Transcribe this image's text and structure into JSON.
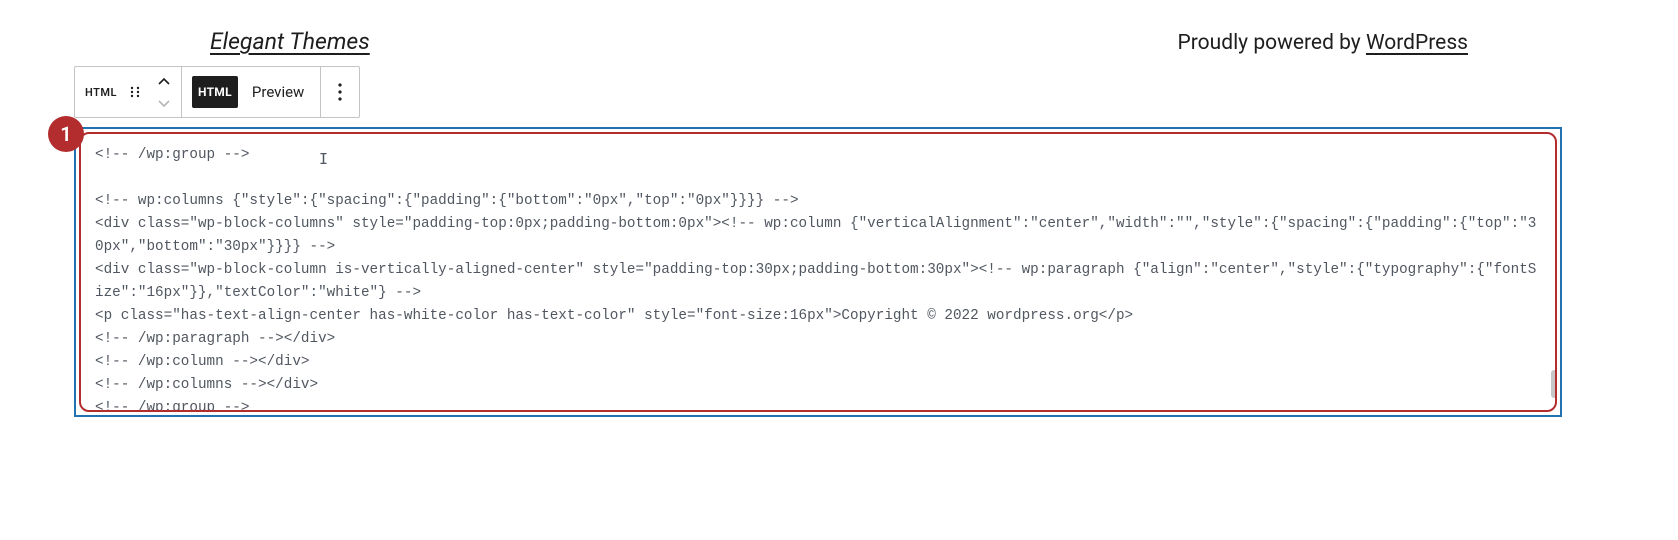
{
  "header": {
    "left_link": "Elegant Themes",
    "right_prefix": "Proudly powered by ",
    "right_link": "WordPress"
  },
  "toolbar": {
    "type_label": "HTML",
    "html_badge": "HTML",
    "preview_label": "Preview"
  },
  "step": {
    "number": "1"
  },
  "code": {
    "line1": "<!-- /wp:group -->",
    "line2": "",
    "line3": "<!-- wp:columns {\"style\":{\"spacing\":{\"padding\":{\"bottom\":\"0px\",\"top\":\"0px\"}}}} -->",
    "line4": "<div class=\"wp-block-columns\" style=\"padding-top:0px;padding-bottom:0px\"><!-- wp:column {\"verticalAlignment\":\"center\",\"width\":\"\",\"style\":{\"spacing\":{\"padding\":{\"top\":\"30px\",\"bottom\":\"30px\"}}}} -->",
    "line5": "<div class=\"wp-block-column is-vertically-aligned-center\" style=\"padding-top:30px;padding-bottom:30px\"><!-- wp:paragraph {\"align\":\"center\",\"style\":{\"typography\":{\"fontSize\":\"16px\"}},\"textColor\":\"white\"} -->",
    "line6": "<p class=\"has-text-align-center has-white-color has-text-color\" style=\"font-size:16px\">Copyright © 2022 wordpress.org</p>",
    "line7": "<!-- /wp:paragraph --></div>",
    "line8": "<!-- /wp:column --></div>",
    "line9": "<!-- /wp:columns --></div>",
    "line10": "<!-- /wp:group -->"
  }
}
